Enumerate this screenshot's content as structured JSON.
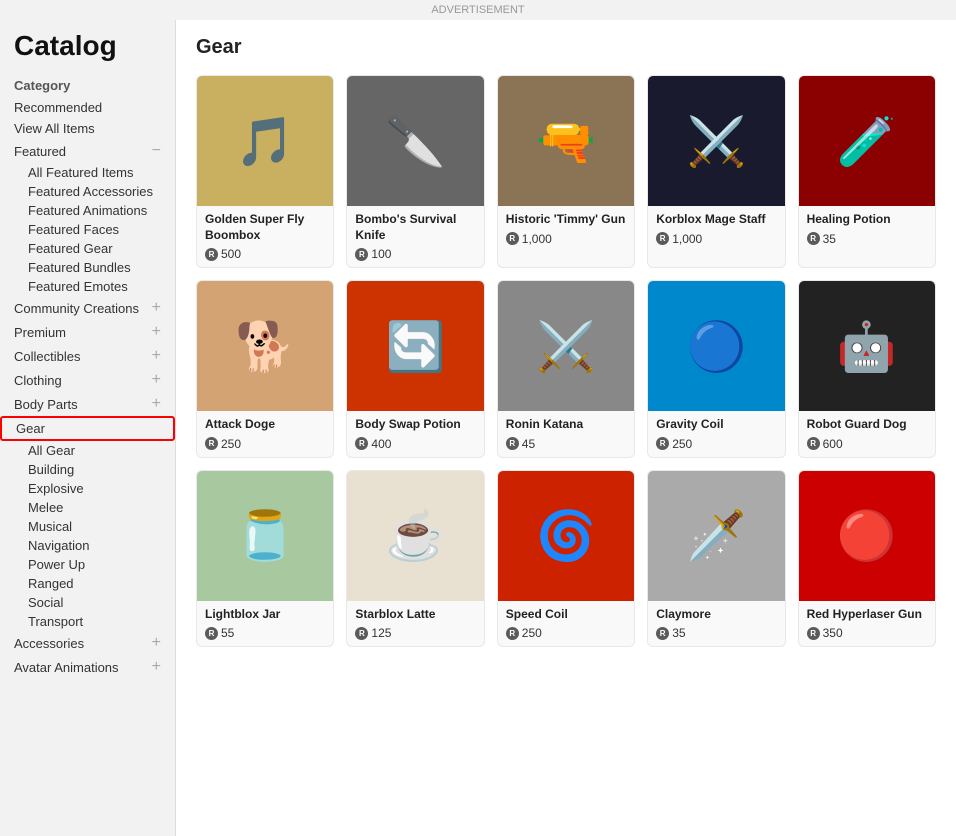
{
  "ad_label": "ADVERTISEMENT",
  "page_title": "Catalog",
  "sidebar": {
    "category_label": "Category",
    "items": [
      {
        "label": "Recommended",
        "type": "top",
        "expandable": false
      },
      {
        "label": "View All Items",
        "type": "top",
        "expandable": false
      },
      {
        "label": "Featured",
        "type": "section",
        "expandable": true,
        "expanded": true,
        "toggle": "−"
      },
      {
        "label": "All Featured Items",
        "type": "sub"
      },
      {
        "label": "Featured Accessories",
        "type": "sub"
      },
      {
        "label": "Featured Animations",
        "type": "sub"
      },
      {
        "label": "Featured Faces",
        "type": "sub"
      },
      {
        "label": "Featured Gear",
        "type": "sub"
      },
      {
        "label": "Featured Bundles",
        "type": "sub"
      },
      {
        "label": "Featured Emotes",
        "type": "sub"
      },
      {
        "label": "Community Creations",
        "type": "section",
        "expandable": true,
        "toggle": "+"
      },
      {
        "label": "Premium",
        "type": "section",
        "expandable": true,
        "toggle": "+"
      },
      {
        "label": "Collectibles",
        "type": "section",
        "expandable": true,
        "toggle": "+"
      },
      {
        "label": "Clothing",
        "type": "section",
        "expandable": true,
        "toggle": "+"
      },
      {
        "label": "Body Parts",
        "type": "section",
        "expandable": true,
        "toggle": "+"
      },
      {
        "label": "Gear",
        "type": "section",
        "expandable": false,
        "active": true
      },
      {
        "label": "All Gear",
        "type": "sub"
      },
      {
        "label": "Building",
        "type": "sub"
      },
      {
        "label": "Explosive",
        "type": "sub"
      },
      {
        "label": "Melee",
        "type": "sub"
      },
      {
        "label": "Musical",
        "type": "sub"
      },
      {
        "label": "Navigation",
        "type": "sub"
      },
      {
        "label": "Power Up",
        "type": "sub"
      },
      {
        "label": "Ranged",
        "type": "sub"
      },
      {
        "label": "Social",
        "type": "sub"
      },
      {
        "label": "Transport",
        "type": "sub"
      },
      {
        "label": "Accessories",
        "type": "section",
        "expandable": true,
        "toggle": "+"
      },
      {
        "label": "Avatar Animations",
        "type": "section",
        "expandable": true,
        "toggle": "+"
      }
    ]
  },
  "content": {
    "title": "Gear",
    "items": [
      {
        "name": "Golden Super Fly Boombox",
        "price": "500",
        "img_class": "img-boombox",
        "emoji": "🎵"
      },
      {
        "name": "Bombo's Survival Knife",
        "price": "100",
        "img_class": "img-knife",
        "emoji": "🔪"
      },
      {
        "name": "Historic 'Timmy' Gun",
        "price": "1,000",
        "img_class": "img-gun",
        "emoji": "🔫"
      },
      {
        "name": "Korblox Mage Staff",
        "price": "1,000",
        "img_class": "img-staff",
        "emoji": "⚔️"
      },
      {
        "name": "Healing Potion",
        "price": "35",
        "img_class": "img-potion",
        "emoji": "🧪"
      },
      {
        "name": "Attack Doge",
        "price": "250",
        "img_class": "img-doge",
        "emoji": "🐕"
      },
      {
        "name": "Body Swap Potion",
        "price": "400",
        "img_class": "img-potion2",
        "emoji": "🔄"
      },
      {
        "name": "Ronin Katana",
        "price": "45",
        "img_class": "img-katana",
        "emoji": "⚔️"
      },
      {
        "name": "Gravity Coil",
        "price": "250",
        "img_class": "img-coil",
        "emoji": "🔵"
      },
      {
        "name": "Robot Guard Dog",
        "price": "600",
        "img_class": "img-dog",
        "emoji": "🤖"
      },
      {
        "name": "Lightblox Jar",
        "price": "55",
        "img_class": "img-jar",
        "emoji": "🫙"
      },
      {
        "name": "Starblox Latte",
        "price": "125",
        "img_class": "img-latte",
        "emoji": "☕"
      },
      {
        "name": "Speed Coil",
        "price": "250",
        "img_class": "img-speedcoil",
        "emoji": "🌀"
      },
      {
        "name": "Claymore",
        "price": "35",
        "img_class": "img-claymore",
        "emoji": "🗡️"
      },
      {
        "name": "Red Hyperlaser Gun",
        "price": "350",
        "img_class": "img-hyperlaser",
        "emoji": "🔴"
      }
    ]
  }
}
